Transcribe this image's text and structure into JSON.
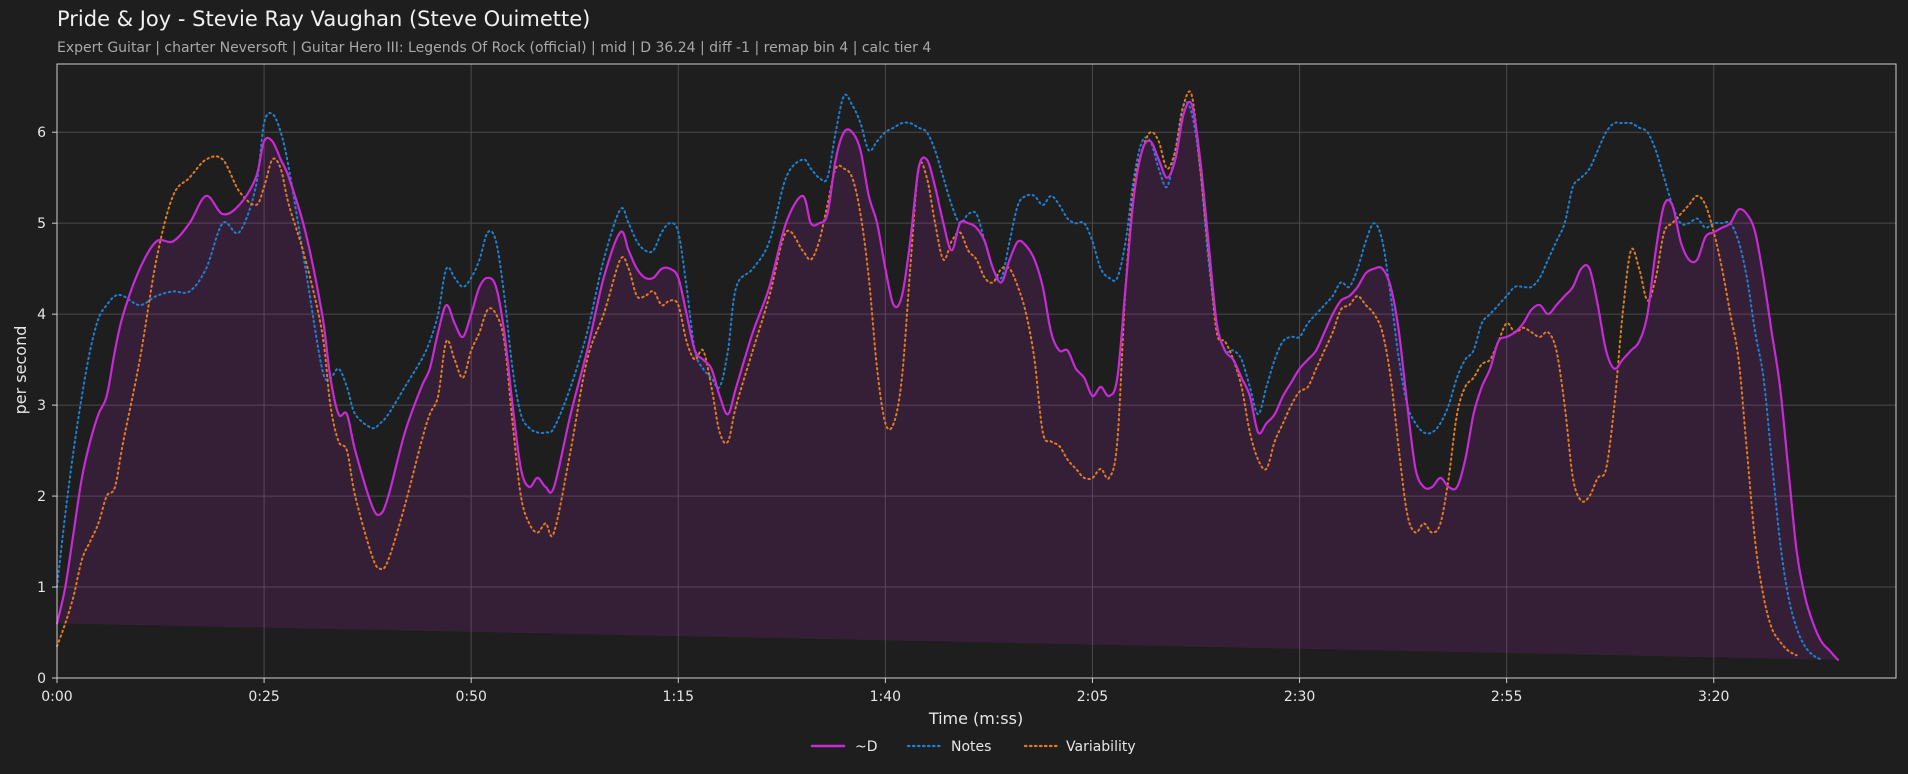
{
  "chart_data": {
    "type": "line",
    "title": "Pride & Joy - Stevie Ray Vaughan (Steve Ouimette)",
    "subtitle": "Expert Guitar  |  charter Neversoft  |  Guitar Hero III: Legends Of Rock (official)  |  mid  |  D 36.24  |  diff -1  |  remap bin 4  |  calc tier 4",
    "xlabel": "Time (m:ss)",
    "ylabel": "per second",
    "xlim": [
      0,
      222
    ],
    "ylim": [
      0,
      6.75
    ],
    "x_ticks": [
      {
        "value": 0,
        "label": "0:00"
      },
      {
        "value": 25,
        "label": "0:25"
      },
      {
        "value": 50,
        "label": "0:50"
      },
      {
        "value": 75,
        "label": "1:15"
      },
      {
        "value": 100,
        "label": "1:40"
      },
      {
        "value": 125,
        "label": "2:05"
      },
      {
        "value": 150,
        "label": "2:30"
      },
      {
        "value": 175,
        "label": "2:55"
      },
      {
        "value": 200,
        "label": "3:20"
      }
    ],
    "y_ticks": [
      {
        "value": 0,
        "label": "0"
      },
      {
        "value": 1,
        "label": "1"
      },
      {
        "value": 2,
        "label": "2"
      },
      {
        "value": 3,
        "label": "3"
      },
      {
        "value": 4,
        "label": "4"
      },
      {
        "value": 5,
        "label": "5"
      },
      {
        "value": 6,
        "label": "6"
      }
    ],
    "grid": true,
    "legend_position": "bottom-center",
    "x": [
      0,
      1,
      2,
      3,
      4,
      5,
      6,
      7,
      8,
      10,
      12,
      14,
      16,
      18,
      20,
      22,
      24,
      25,
      26,
      27,
      28,
      30,
      32,
      33,
      34,
      35,
      36,
      38,
      39,
      40,
      42,
      44,
      45,
      46,
      47,
      48,
      49,
      50,
      51,
      52,
      53,
      54,
      55,
      56,
      57,
      58,
      59,
      60,
      62,
      64,
      66,
      68,
      69,
      70,
      71,
      72,
      73,
      74,
      75,
      76,
      77,
      78,
      79,
      80,
      81,
      82,
      84,
      86,
      88,
      90,
      91,
      92,
      93,
      94,
      95,
      96,
      97,
      98,
      99,
      100,
      101,
      102,
      103,
      104,
      105,
      106,
      107,
      108,
      109,
      110,
      111,
      112,
      113,
      114,
      115,
      116,
      117,
      118,
      119,
      120,
      121,
      122,
      123,
      124,
      125,
      126,
      127,
      128,
      129,
      130,
      131,
      132,
      133,
      134,
      135,
      136,
      137,
      138,
      139,
      140,
      141,
      142,
      143,
      144,
      145,
      146,
      147,
      148,
      149,
      150,
      151,
      152,
      153,
      154,
      155,
      156,
      157,
      158,
      159,
      160,
      161,
      162,
      163,
      164,
      165,
      166,
      167,
      168,
      169,
      170,
      171,
      172,
      173,
      174,
      175,
      176,
      177,
      178,
      179,
      180,
      181,
      182,
      183,
      184,
      185,
      186,
      187,
      188,
      189,
      190,
      191,
      192,
      193,
      194,
      195,
      196,
      197,
      198,
      199,
      200,
      201,
      202,
      203,
      204,
      205,
      206,
      207,
      208,
      209,
      210,
      211,
      212,
      213,
      214,
      215,
      216,
      217,
      218,
      219,
      220,
      221,
      222
    ],
    "series": [
      {
        "name": "~D",
        "color": "#c62bd4",
        "style": "solid",
        "values": [
          0.6,
          1.0,
          1.6,
          2.2,
          2.6,
          2.9,
          3.1,
          3.6,
          4.0,
          4.5,
          4.8,
          4.8,
          5.0,
          5.3,
          5.1,
          5.2,
          5.5,
          5.9,
          5.9,
          5.7,
          5.5,
          4.9,
          4.0,
          3.3,
          2.9,
          2.9,
          2.5,
          1.9,
          1.8,
          2.0,
          2.7,
          3.2,
          3.4,
          3.8,
          4.1,
          3.9,
          3.75,
          4.0,
          4.3,
          4.4,
          4.3,
          3.8,
          3.0,
          2.3,
          2.1,
          2.2,
          2.1,
          2.1,
          2.9,
          3.6,
          4.4,
          4.9,
          4.7,
          4.5,
          4.4,
          4.4,
          4.5,
          4.5,
          4.4,
          4.0,
          3.6,
          3.5,
          3.4,
          3.1,
          2.9,
          3.2,
          3.8,
          4.3,
          5.0,
          5.3,
          5.0,
          5.0,
          5.1,
          5.7,
          6.0,
          6.0,
          5.8,
          5.3,
          5.0,
          4.5,
          4.1,
          4.2,
          4.8,
          5.6,
          5.7,
          5.4,
          5.0,
          4.7,
          5.0,
          5.0,
          4.95,
          4.8,
          4.5,
          4.35,
          4.6,
          4.8,
          4.75,
          4.6,
          4.3,
          3.8,
          3.6,
          3.6,
          3.4,
          3.3,
          3.1,
          3.2,
          3.1,
          3.3,
          4.3,
          5.3,
          5.8,
          5.9,
          5.7,
          5.5,
          5.7,
          6.2,
          6.3,
          5.7,
          4.8,
          3.9,
          3.6,
          3.5,
          3.3,
          3.1,
          2.7,
          2.8,
          2.9,
          3.1,
          3.25,
          3.4,
          3.5,
          3.6,
          3.8,
          4.0,
          4.15,
          4.2,
          4.3,
          4.45,
          4.5,
          4.5,
          4.3,
          3.8,
          3.0,
          2.3,
          2.1,
          2.1,
          2.2,
          2.1,
          2.1,
          2.4,
          2.9,
          3.2,
          3.4,
          3.7,
          3.75,
          3.8,
          3.9,
          4.05,
          4.1,
          4.0,
          4.1,
          4.2,
          4.3,
          4.5,
          4.5,
          4.1,
          3.6,
          3.4,
          3.5,
          3.6,
          3.7,
          4.0,
          4.7,
          5.2,
          5.2,
          4.8,
          4.6,
          4.6,
          4.85,
          4.9,
          4.95,
          5.0,
          5.15,
          5.1,
          4.9,
          4.4,
          3.8,
          3.2,
          2.3,
          1.4,
          0.9,
          0.6,
          0.4,
          0.3,
          0.2,
          0.15
        ]
      },
      {
        "name": "Notes",
        "color": "#1f7fd0",
        "style": "dotted",
        "values": [
          1.0,
          1.8,
          2.5,
          3.1,
          3.6,
          3.95,
          4.1,
          4.2,
          4.2,
          4.1,
          4.2,
          4.25,
          4.25,
          4.5,
          5.0,
          4.9,
          5.4,
          6.1,
          6.2,
          6.0,
          5.6,
          4.5,
          3.4,
          3.3,
          3.4,
          3.2,
          2.9,
          2.75,
          2.8,
          2.9,
          3.2,
          3.5,
          3.7,
          4.0,
          4.5,
          4.4,
          4.3,
          4.4,
          4.6,
          4.9,
          4.8,
          4.2,
          3.4,
          2.9,
          2.75,
          2.7,
          2.7,
          2.75,
          3.2,
          3.8,
          4.6,
          5.15,
          5.0,
          4.8,
          4.7,
          4.7,
          4.9,
          5.0,
          4.9,
          4.3,
          3.6,
          3.4,
          3.3,
          3.2,
          3.6,
          4.3,
          4.5,
          4.8,
          5.5,
          5.7,
          5.6,
          5.5,
          5.5,
          6.0,
          6.4,
          6.3,
          6.1,
          5.8,
          5.9,
          6.0,
          6.05,
          6.1,
          6.1,
          6.05,
          6.0,
          5.8,
          5.5,
          5.2,
          5.0,
          5.1,
          5.1,
          4.8,
          4.5,
          4.4,
          4.8,
          5.2,
          5.3,
          5.3,
          5.2,
          5.3,
          5.2,
          5.05,
          5.0,
          5.0,
          4.8,
          4.5,
          4.4,
          4.4,
          4.8,
          5.5,
          5.9,
          5.9,
          5.6,
          5.4,
          5.8,
          6.3,
          6.2,
          5.6,
          4.6,
          3.9,
          3.6,
          3.6,
          3.5,
          3.2,
          2.9,
          3.2,
          3.5,
          3.7,
          3.75,
          3.75,
          3.9,
          4.0,
          4.1,
          4.2,
          4.35,
          4.3,
          4.5,
          4.8,
          5.0,
          4.8,
          4.2,
          3.5,
          3.0,
          2.8,
          2.7,
          2.7,
          2.8,
          3.0,
          3.3,
          3.5,
          3.6,
          3.9,
          4.0,
          4.1,
          4.2,
          4.3,
          4.3,
          4.3,
          4.4,
          4.6,
          4.8,
          5.0,
          5.4,
          5.5,
          5.6,
          5.8,
          6.0,
          6.1,
          6.1,
          6.1,
          6.05,
          6.0,
          5.8,
          5.5,
          5.2,
          5.0,
          5.0,
          5.05,
          4.95,
          5.0,
          5.0,
          5.0,
          4.8,
          4.4,
          3.8,
          3.3,
          2.4,
          1.5,
          0.9,
          0.55,
          0.35,
          0.25,
          0.2,
          0.15
        ]
      },
      {
        "name": "Variability",
        "color": "#e07b22",
        "style": "dotted",
        "values": [
          0.35,
          0.6,
          0.9,
          1.3,
          1.5,
          1.7,
          2.0,
          2.1,
          2.6,
          3.5,
          4.6,
          5.3,
          5.5,
          5.7,
          5.7,
          5.35,
          5.2,
          5.4,
          5.7,
          5.6,
          5.2,
          4.6,
          3.8,
          3.0,
          2.6,
          2.5,
          2.0,
          1.35,
          1.2,
          1.3,
          1.9,
          2.6,
          2.9,
          3.1,
          3.7,
          3.5,
          3.3,
          3.6,
          3.8,
          4.05,
          4.0,
          3.7,
          2.8,
          2.0,
          1.7,
          1.6,
          1.7,
          1.6,
          2.5,
          3.5,
          4.0,
          4.6,
          4.5,
          4.2,
          4.2,
          4.25,
          4.1,
          4.15,
          4.1,
          3.7,
          3.5,
          3.6,
          3.2,
          2.7,
          2.6,
          3.0,
          3.6,
          4.2,
          4.9,
          4.7,
          4.6,
          4.8,
          5.2,
          5.6,
          5.6,
          5.5,
          5.1,
          4.4,
          3.4,
          2.8,
          2.8,
          3.3,
          4.5,
          5.6,
          5.5,
          5.0,
          4.6,
          4.8,
          4.9,
          4.7,
          4.6,
          4.4,
          4.35,
          4.5,
          4.5,
          4.3,
          4.0,
          3.5,
          2.7,
          2.6,
          2.55,
          2.4,
          2.3,
          2.2,
          2.2,
          2.3,
          2.2,
          2.6,
          4.3,
          5.4,
          5.8,
          6.0,
          5.9,
          5.6,
          5.8,
          6.3,
          6.4,
          5.6,
          4.7,
          3.8,
          3.7,
          3.5,
          3.2,
          2.7,
          2.4,
          2.3,
          2.6,
          2.8,
          3.0,
          3.15,
          3.2,
          3.4,
          3.6,
          3.8,
          4.05,
          4.1,
          4.2,
          4.1,
          4.0,
          3.8,
          3.3,
          2.5,
          1.8,
          1.6,
          1.7,
          1.6,
          1.7,
          2.2,
          2.9,
          3.2,
          3.3,
          3.45,
          3.5,
          3.7,
          3.9,
          3.8,
          3.85,
          3.8,
          3.75,
          3.8,
          3.6,
          3.0,
          2.2,
          1.95,
          2.0,
          2.2,
          2.3,
          3.0,
          4.0,
          4.7,
          4.5,
          4.15,
          4.4,
          4.9,
          5.0,
          5.1,
          5.2,
          5.3,
          5.2,
          4.9,
          4.5,
          4.0,
          3.5,
          2.5,
          1.5,
          0.9,
          0.55,
          0.4,
          0.3,
          0.25,
          0.2
        ]
      }
    ],
    "fill_series": "~D",
    "fill_color": "#c62bd4"
  }
}
